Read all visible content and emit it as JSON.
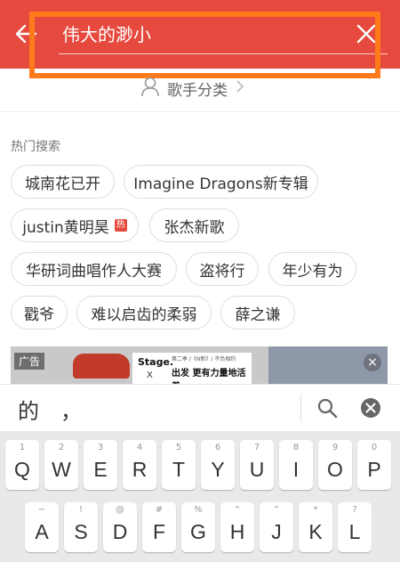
{
  "header": {
    "search_value": "伟大的渺小",
    "bg_color": "#e64a3f"
  },
  "singer_category": {
    "label": "歌手分类"
  },
  "hot_search": {
    "title": "热门搜索",
    "tags": [
      {
        "label": "城南花已开"
      },
      {
        "label": "Imagine Dragons新专辑"
      },
      {
        "label": "justin黄明昊",
        "badge": "热"
      },
      {
        "label": "张杰新歌"
      },
      {
        "label": "华研词曲唱作人大赛"
      },
      {
        "label": "盗将行"
      },
      {
        "label": "年少有为"
      },
      {
        "label": "戳爷"
      },
      {
        "label": "难以启齿的柔弱"
      },
      {
        "label": "薛之谦"
      }
    ]
  },
  "ad": {
    "label": "广告",
    "brand": "Stage.",
    "x_mark": "X",
    "small_text": "第二季 /《N新》/ 不负相约",
    "headline": "出发 更有力量地活着"
  },
  "ime": {
    "candidates": "的　，"
  },
  "keyboard": {
    "row1": [
      {
        "hint": "1",
        "key": "Q"
      },
      {
        "hint": "2",
        "key": "W"
      },
      {
        "hint": "3",
        "key": "E"
      },
      {
        "hint": "4",
        "key": "R"
      },
      {
        "hint": "5",
        "key": "T"
      },
      {
        "hint": "6",
        "key": "Y"
      },
      {
        "hint": "7",
        "key": "U"
      },
      {
        "hint": "8",
        "key": "I"
      },
      {
        "hint": "9",
        "key": "O"
      },
      {
        "hint": "0",
        "key": "P"
      }
    ],
    "row2": [
      {
        "hint": "~",
        "key": "A"
      },
      {
        "hint": "!",
        "key": "S"
      },
      {
        "hint": "@",
        "key": "D"
      },
      {
        "hint": "#",
        "key": "F"
      },
      {
        "hint": "%",
        "key": "G"
      },
      {
        "hint": "“",
        "key": "H"
      },
      {
        "hint": "”",
        "key": "J"
      },
      {
        "hint": "*",
        "key": "K"
      },
      {
        "hint": "?",
        "key": "L"
      }
    ]
  }
}
